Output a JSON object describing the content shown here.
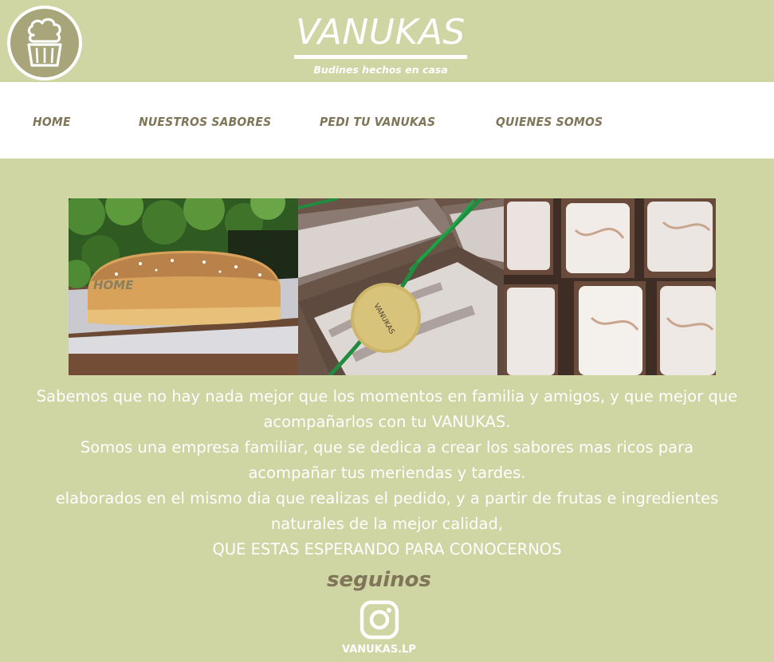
{
  "header": {
    "brand": "VANUKAS",
    "tagline": "Budines hechos en casa",
    "logo_icon": "cupcake-icon"
  },
  "nav": {
    "items": [
      {
        "label": "HOME"
      },
      {
        "label": "NUESTROS SABORES"
      },
      {
        "label": "PEDI TU VANUKAS"
      },
      {
        "label": "QUIENES SOMOS"
      }
    ]
  },
  "gallery": {
    "overlay_label": "HOME",
    "photos": [
      "lemon-loaf-photo",
      "marble-loaves-photo",
      "glazed-loaves-photo"
    ]
  },
  "intro": {
    "lines": [
      "Sabemos que no hay nada mejor que los momentos en familia y amigos, y que mejor que acompañarlos con tu VANUKAS.",
      "Somos una empresa familiar, que se dedica a crear los sabores mas ricos para acompañar tus meriendas y tardes.",
      "elaborados en el mismo dia que realizas el pedido, y a partir de frutas e ingredientes naturales de la mejor calidad,",
      "QUE ESTAS ESPERANDO PARA CONOCERNOS"
    ]
  },
  "social": {
    "heading": "seguinos",
    "icon": "instagram-icon",
    "handle": "VANUKAS.LP"
  },
  "colors": {
    "background": "#cfd5a3",
    "nav_background": "#ffffff",
    "nav_text": "#7f7558",
    "logo_fill": "#a8a57a",
    "text_light": "#ffffff"
  }
}
